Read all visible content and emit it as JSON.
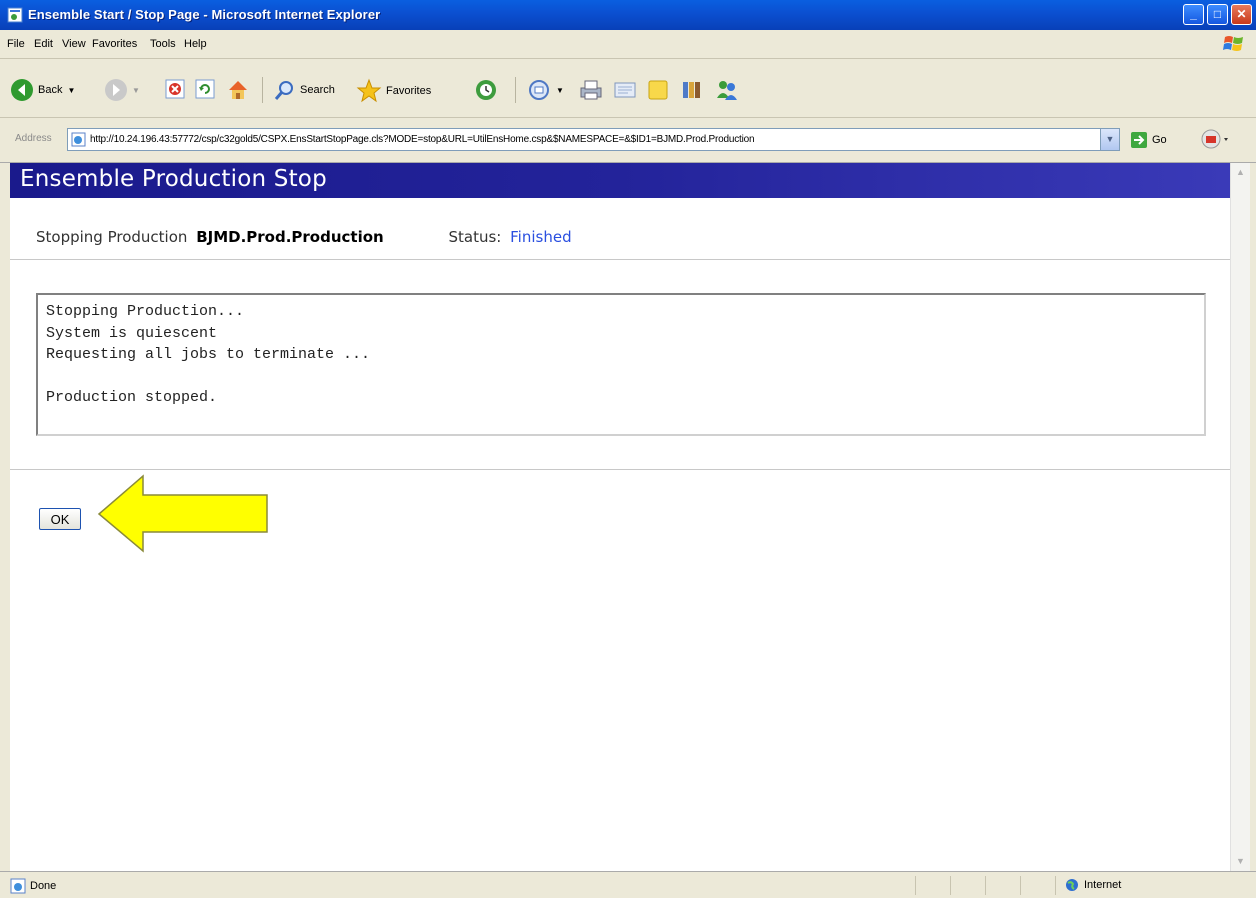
{
  "window": {
    "title": "Ensemble Start / Stop Page - Microsoft Internet Explorer",
    "min_glyph": "_",
    "max_glyph": "□",
    "close_glyph": "✕"
  },
  "menu": {
    "items": [
      "File",
      "Edit",
      "View",
      "Favorites",
      "Tools",
      "Help"
    ]
  },
  "toolbar": {
    "back_label": "Back",
    "search_label": "Search",
    "favorites_label": "Favorites",
    "icons": [
      "back-icon",
      "forward-icon",
      "stop-icon",
      "refresh-icon",
      "home-icon",
      "search-icon",
      "favorites-star-icon",
      "history-icon",
      "mail-icon",
      "print-icon",
      "edit-icon",
      "discuss-icon",
      "research-icon",
      "messenger-icon"
    ]
  },
  "address": {
    "label": "Address",
    "url": "http://10.24.196.43:57772/csp/c32gold5/CSPX.EnsStartStopPage.cls?MODE=stop&URL=UtilEnsHome.csp&$NAMESPACE=&$ID1=BJMD.Prod.Production",
    "go_label": "Go"
  },
  "page": {
    "heading": "Ensemble Production Stop",
    "stopping_label": "Stopping Production",
    "production_name": "BJMD.Prod.Production",
    "status_label": "Status:",
    "status_value": "Finished",
    "log_lines": [
      "Stopping Production...",
      "System is quiescent",
      "Requesting all jobs to terminate ...",
      "",
      "Production stopped."
    ],
    "ok_label": "OK"
  },
  "statusbar": {
    "left_text": "Done",
    "zone_text": "Internet"
  },
  "colors": {
    "titlebar": "#0a5fe0",
    "header_bar": "#1a1a8c",
    "status_value": "#2a4fe0",
    "arrow_fill": "#ffff00"
  }
}
